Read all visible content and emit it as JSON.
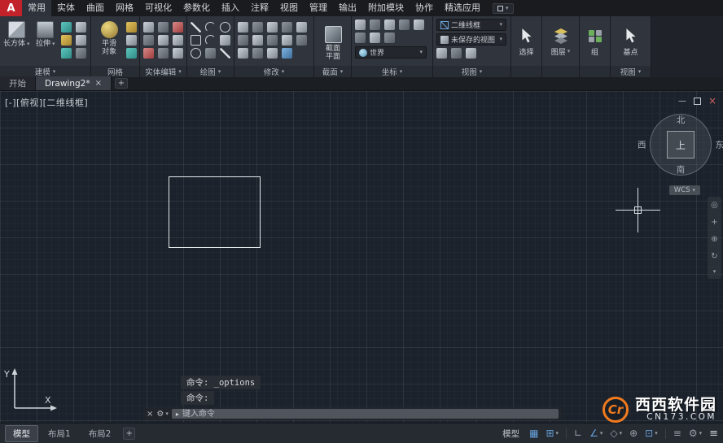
{
  "app_logo": "A",
  "menubar": {
    "items": [
      "常用",
      "实体",
      "曲面",
      "网格",
      "可视化",
      "参数化",
      "插入",
      "注释",
      "视图",
      "管理",
      "输出",
      "附加模块",
      "协作",
      "精选应用"
    ]
  },
  "ribbon": {
    "modeling": {
      "label": "建模",
      "box": "长方体",
      "extrude": "拉伸"
    },
    "mesh": {
      "label": "网格",
      "smooth1": "平滑",
      "smooth2": "对象"
    },
    "solid_editing": {
      "label": "实体编辑"
    },
    "draw": {
      "label": "绘图"
    },
    "modify": {
      "label": "修改"
    },
    "section": {
      "label": "截面",
      "plane1": "截面",
      "plane2": "平面"
    },
    "coordinates": {
      "label": "坐标",
      "world": "世界"
    },
    "view": {
      "label": "视图",
      "visual_style": "二维线框",
      "named_view": "未保存的视图"
    },
    "select": {
      "label": "选择"
    },
    "layers": {
      "label": "图层"
    },
    "groups": {
      "label": "组"
    },
    "viewpanel": {
      "label": "视图",
      "base": "基点"
    }
  },
  "filetabs": {
    "start": "开始",
    "drawing": "Drawing2*",
    "close": "×",
    "new": "+"
  },
  "canvas": {
    "viewport_label": "[-][俯视][二维线框]",
    "viewcube": {
      "n": "北",
      "s": "南",
      "e": "东",
      "w": "西",
      "top": "上",
      "wcs": "WCS"
    },
    "ucs": {
      "x": "X",
      "y": "Y"
    },
    "history1": "命令: _options",
    "history2": "命令:"
  },
  "cmdline": {
    "placeholder": "键入命令"
  },
  "statusbar": {
    "tabs": [
      "模型",
      "布局1",
      "布局2"
    ],
    "new_layout": "+",
    "model": "模型"
  },
  "watermark": {
    "logo": "Cr",
    "name": "西西软件园",
    "url": "CN173.COM"
  },
  "icons": {
    "caret": "▾",
    "caret_right": "▸",
    "close": "×",
    "minimize": "—",
    "hamburger": "≡",
    "gear": "⚙",
    "grid": "▦",
    "snap": "⊞",
    "ortho": "∟",
    "polar": "∠",
    "iso": "◇",
    "otrack": "⊕",
    "osnap": "⊡",
    "wheel": "◎",
    "pan": "+",
    "orbit": "↻"
  }
}
